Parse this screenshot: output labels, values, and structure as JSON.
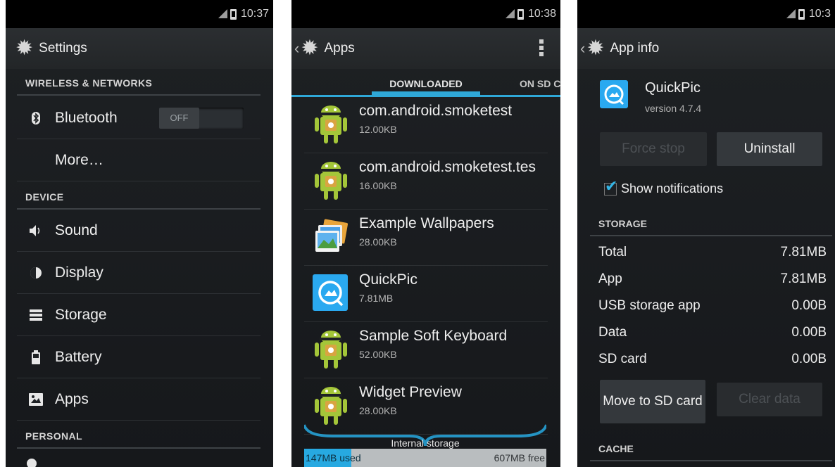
{
  "colors": {
    "accent": "#33b5e5",
    "background": "#1b1e21",
    "statusbar": "#000000"
  },
  "screen1": {
    "status_time": "10:37",
    "title": "Settings",
    "sections": {
      "wireless": "WIRELESS & NETWORKS",
      "device": "DEVICE",
      "personal": "PERSONAL"
    },
    "bluetooth": {
      "label": "Bluetooth",
      "toggle": "OFF"
    },
    "more": "More…",
    "sound": "Sound",
    "display": "Display",
    "storage": "Storage",
    "battery": "Battery",
    "apps": "Apps"
  },
  "screen2": {
    "status_time": "10:38",
    "title": "Apps",
    "tabs": {
      "downloaded": "DOWNLOADED",
      "on_sd": "ON SD C"
    },
    "apps": [
      {
        "name": "com.android.smoketest",
        "size": "12.00KB",
        "icon": "android-icon"
      },
      {
        "name": "com.android.smoketest.tes",
        "size": "16.00KB",
        "icon": "android-icon"
      },
      {
        "name": "Example Wallpapers",
        "size": "28.00KB",
        "icon": "wallpapers-icon"
      },
      {
        "name": "QuickPic",
        "size": "7.81MB",
        "icon": "quickpic-icon"
      },
      {
        "name": "Sample Soft Keyboard",
        "size": "52.00KB",
        "icon": "android-icon"
      },
      {
        "name": "Widget Preview",
        "size": "28.00KB",
        "icon": "android-icon"
      }
    ],
    "storage": {
      "label": "Internal storage",
      "used": "147MB used",
      "free": "607MB free",
      "used_fraction": 0.195
    }
  },
  "screen3": {
    "status_time": "10:3",
    "title": "App info",
    "app_name": "QuickPic",
    "version": "version 4.7.4",
    "force_stop": "Force stop",
    "uninstall": "Uninstall",
    "show_notifications": "Show notifications",
    "storage_header": "STORAGE",
    "rows": [
      {
        "label": "Total",
        "value": "7.81MB"
      },
      {
        "label": "App",
        "value": "7.81MB"
      },
      {
        "label": "USB storage app",
        "value": "0.00B"
      },
      {
        "label": "Data",
        "value": "0.00B"
      },
      {
        "label": "SD card",
        "value": "0.00B"
      }
    ],
    "move_to_sd": "Move to SD card",
    "clear_data": "Clear data",
    "cache_header": "CACHE"
  }
}
